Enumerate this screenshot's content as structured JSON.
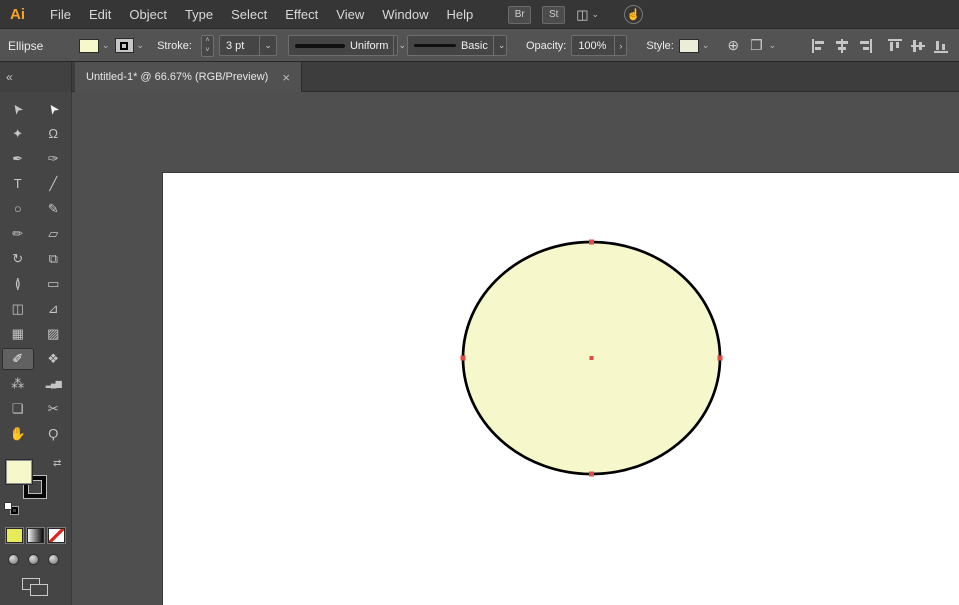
{
  "menu_bar": {
    "logo": "Ai",
    "items": [
      "File",
      "Edit",
      "Object",
      "Type",
      "Select",
      "Effect",
      "View",
      "Window",
      "Help"
    ],
    "bridge_button": "Br",
    "stock_button": "St"
  },
  "control_bar": {
    "context_label": "Ellipse",
    "labels": {
      "stroke": "Stroke:",
      "opacity": "Opacity:",
      "style": "Style:"
    },
    "stroke_weight": "3 pt",
    "width_profile": "Uniform",
    "brush": "Basic",
    "opacity": "100%"
  },
  "tab_bar": {
    "active_tab": "Untitled-1* @ 66.67% (RGB/Preview)",
    "close": "×"
  },
  "icons": {
    "collapse_panel": "«",
    "chevron_down": "⌄",
    "chevron_right": "›",
    "stepper_up": "˄",
    "stepper_down": "˅",
    "swap_arrows": "⇄",
    "globe": "⊕",
    "doc_arrange": "❒",
    "workspace": "◫",
    "touch": "☝"
  },
  "tools": [
    {
      "name": "selection-tool",
      "glyph": "➤"
    },
    {
      "name": "direct-selection-tool",
      "glyph": "➤"
    },
    {
      "name": "magic-wand-tool",
      "glyph": "✦"
    },
    {
      "name": "lasso-tool",
      "glyph": "Ω"
    },
    {
      "name": "pen-tool",
      "glyph": "✒"
    },
    {
      "name": "curvature-tool",
      "glyph": "✑"
    },
    {
      "name": "type-tool",
      "glyph": "T"
    },
    {
      "name": "line-segment-tool",
      "glyph": "╱"
    },
    {
      "name": "ellipse-tool",
      "glyph": "○"
    },
    {
      "name": "paintbrush-tool",
      "glyph": "✎"
    },
    {
      "name": "shaper-tool",
      "glyph": "✏"
    },
    {
      "name": "eraser-tool",
      "glyph": "▱"
    },
    {
      "name": "rotate-tool",
      "glyph": "↻"
    },
    {
      "name": "scale-tool",
      "glyph": "⧉"
    },
    {
      "name": "width-tool",
      "glyph": "≬"
    },
    {
      "name": "free-transform-tool",
      "glyph": "▭"
    },
    {
      "name": "shape-builder-tool",
      "glyph": "◫"
    },
    {
      "name": "perspective-grid-tool",
      "glyph": "⊿"
    },
    {
      "name": "mesh-tool",
      "glyph": "▦"
    },
    {
      "name": "gradient-tool",
      "glyph": "▨"
    },
    {
      "name": "eyedropper-tool",
      "glyph": "✐"
    },
    {
      "name": "blend-tool",
      "glyph": "❖"
    },
    {
      "name": "symbol-sprayer-tool",
      "glyph": "⁂"
    },
    {
      "name": "column-graph-tool",
      "glyph": "▂▄▆"
    },
    {
      "name": "artboard-tool",
      "glyph": "❏"
    },
    {
      "name": "slice-tool",
      "glyph": "✂"
    },
    {
      "name": "hand-tool",
      "glyph": "✋"
    },
    {
      "name": "zoom-tool",
      "glyph": "Ϙ"
    }
  ],
  "colors": {
    "fill": "#F7F7CC",
    "stroke": "#000000",
    "selection": "#E14B45",
    "style_swatch": "#ECECDA",
    "color_button": "#E6EB5A"
  },
  "shape": {
    "type": "ellipse",
    "fill": "#F7F7CC",
    "stroke": "#000000",
    "stroke_width_px": "2.7"
  }
}
